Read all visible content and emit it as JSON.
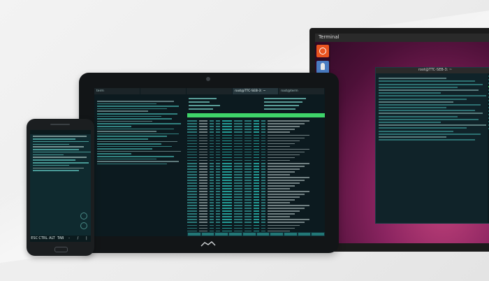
{
  "desktop": {
    "panel_title": "Terminal",
    "terminal_title": "root@TTC-SEB-3: ~",
    "launcher_icons": [
      "ubuntu-icon",
      "app-icon"
    ]
  },
  "tablet": {
    "tabs": [
      "term",
      "",
      "",
      "root@TTC-SEB-3: ~",
      "root@term"
    ],
    "active_tab_index": 3
  },
  "phone": {
    "extra_keys": [
      "ESC",
      "CTRL",
      "ALT",
      "TAB",
      "-",
      "/",
      "|"
    ]
  },
  "colors": {
    "terminal_bg": "#0c1a1f",
    "terminal_text": "#3fa6a2",
    "highlight_bar": "#3fd56a",
    "ubuntu_orange": "#e95420",
    "desktop_wallpaper": "#8a2460"
  }
}
